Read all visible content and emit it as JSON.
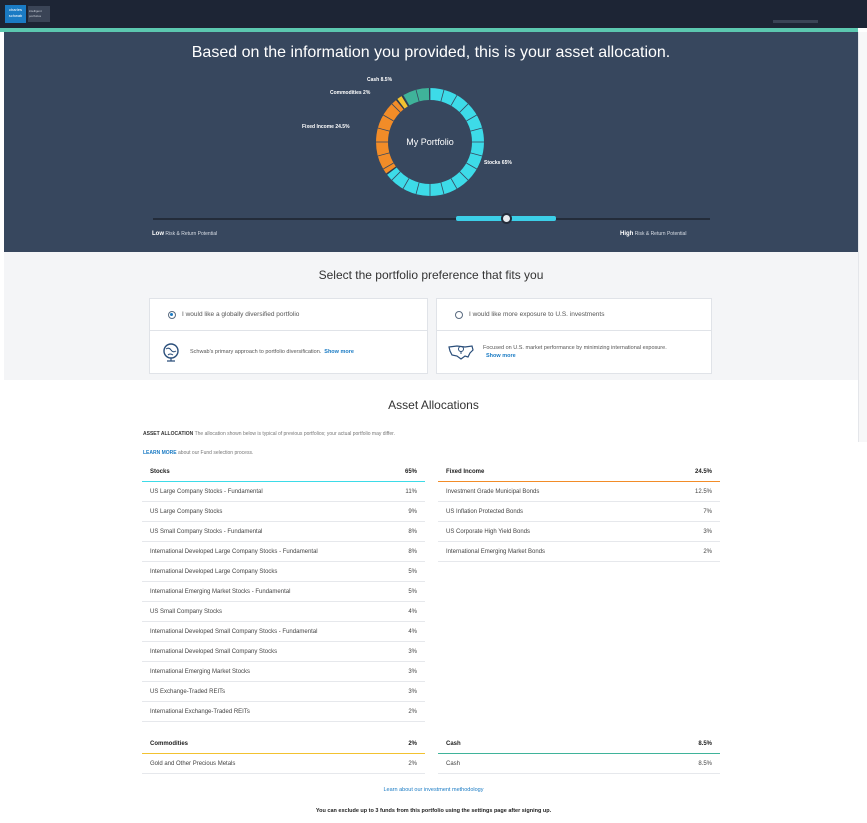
{
  "header": {
    "logo_text": "charles schwab",
    "logo_sub": "intelligent portfolios"
  },
  "hero": {
    "title": "Based on the information you provided, this is your asset allocation.",
    "donut_center": "My Portfolio",
    "labels": {
      "cash": "Cash 8.5%",
      "commodities": "Commodities 2%",
      "fixed_income": "Fixed Income 24.5%",
      "stocks": "Stocks 65%"
    },
    "allocation": [
      {
        "name": "Stocks",
        "pct": 65,
        "color": "#3ddbe8"
      },
      {
        "name": "Fixed Income",
        "pct": 24.5,
        "color": "#f28c28"
      },
      {
        "name": "Commodities",
        "pct": 2,
        "color": "#f2c230"
      },
      {
        "name": "Cash",
        "pct": 8.5,
        "color": "#3fb39a"
      }
    ],
    "risk_level": 0.63,
    "risk_low": {
      "strong": "Low",
      "rest": "Risk & Return Potential"
    },
    "risk_high": {
      "strong": "High",
      "rest": "Risk & Return Potential"
    }
  },
  "preference": {
    "title": "Select the portfolio preference that fits you",
    "option1": {
      "label": "I would like a globally diversified portfolio",
      "desc": "Schwab's primary approach to portfolio diversification.",
      "show_more": "Show more",
      "selected": true,
      "icon": "globe-icon"
    },
    "option2": {
      "label": "I would like more exposure to U.S. investments",
      "desc": "Focused on U.S. market performance by minimizing international exposure.",
      "show_more": "Show more",
      "selected": false,
      "icon": "us-map-icon"
    }
  },
  "allocations": {
    "title": "Asset Allocations",
    "desc_strong": "ASSET ALLOCATION",
    "desc": "The allocation shown below is typical of previous portfolios; your actual portfolio may differ.",
    "learn_more_link": "LEARN MORE",
    "learn_more_text": "about our Fund selection process.",
    "stocks": {
      "name": "Stocks",
      "total": "65%",
      "color": "#3ddbe8",
      "rows": [
        {
          "name": "US Large Company Stocks - Fundamental",
          "pct": "11%"
        },
        {
          "name": "US Large Company Stocks",
          "pct": "9%"
        },
        {
          "name": "US Small Company Stocks - Fundamental",
          "pct": "8%"
        },
        {
          "name": "International Developed Large Company Stocks - Fundamental",
          "pct": "8%"
        },
        {
          "name": "International Developed Large Company Stocks",
          "pct": "5%"
        },
        {
          "name": "International Emerging Market Stocks - Fundamental",
          "pct": "5%"
        },
        {
          "name": "US Small Company Stocks",
          "pct": "4%"
        },
        {
          "name": "International Developed Small Company Stocks - Fundamental",
          "pct": "4%"
        },
        {
          "name": "International Developed Small Company Stocks",
          "pct": "3%"
        },
        {
          "name": "International Emerging Market Stocks",
          "pct": "3%"
        },
        {
          "name": "US Exchange-Traded REITs",
          "pct": "3%"
        },
        {
          "name": "International Exchange-Traded REITs",
          "pct": "2%"
        }
      ]
    },
    "fixed_income": {
      "name": "Fixed Income",
      "total": "24.5%",
      "color": "#f28c28",
      "rows": [
        {
          "name": "Investment Grade Municipal Bonds",
          "pct": "12.5%"
        },
        {
          "name": "US Inflation Protected Bonds",
          "pct": "7%"
        },
        {
          "name": "US Corporate High Yield Bonds",
          "pct": "3%"
        },
        {
          "name": "International Emerging Market Bonds",
          "pct": "2%"
        }
      ]
    },
    "commodities": {
      "name": "Commodities",
      "total": "2%",
      "color": "#f2c230",
      "rows": [
        {
          "name": "Gold and Other Precious Metals",
          "pct": "2%"
        }
      ]
    },
    "cash": {
      "name": "Cash",
      "total": "8.5%",
      "color": "#3fb39a",
      "rows": [
        {
          "name": "Cash",
          "pct": "8.5%"
        }
      ]
    }
  },
  "footer": {
    "link": "Learn about our investment methodology",
    "note": "You can exclude up to 3 funds from this portfolio using the settings page after signing up."
  }
}
